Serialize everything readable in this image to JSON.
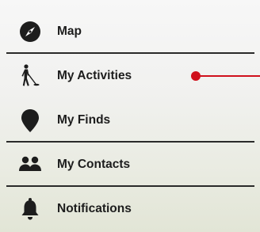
{
  "menu": {
    "items": [
      {
        "label": "Map",
        "icon": "compass-icon"
      },
      {
        "label": "My Activities",
        "icon": "metal-detector-person-icon"
      },
      {
        "label": "My Finds",
        "icon": "map-pin-icon"
      },
      {
        "label": "My Contacts",
        "icon": "people-icon"
      },
      {
        "label": "Notifications",
        "icon": "bell-icon"
      }
    ]
  },
  "colors": {
    "accent": "#d0101c",
    "text": "#1d1d1d",
    "divider": "#2a2a2a"
  }
}
